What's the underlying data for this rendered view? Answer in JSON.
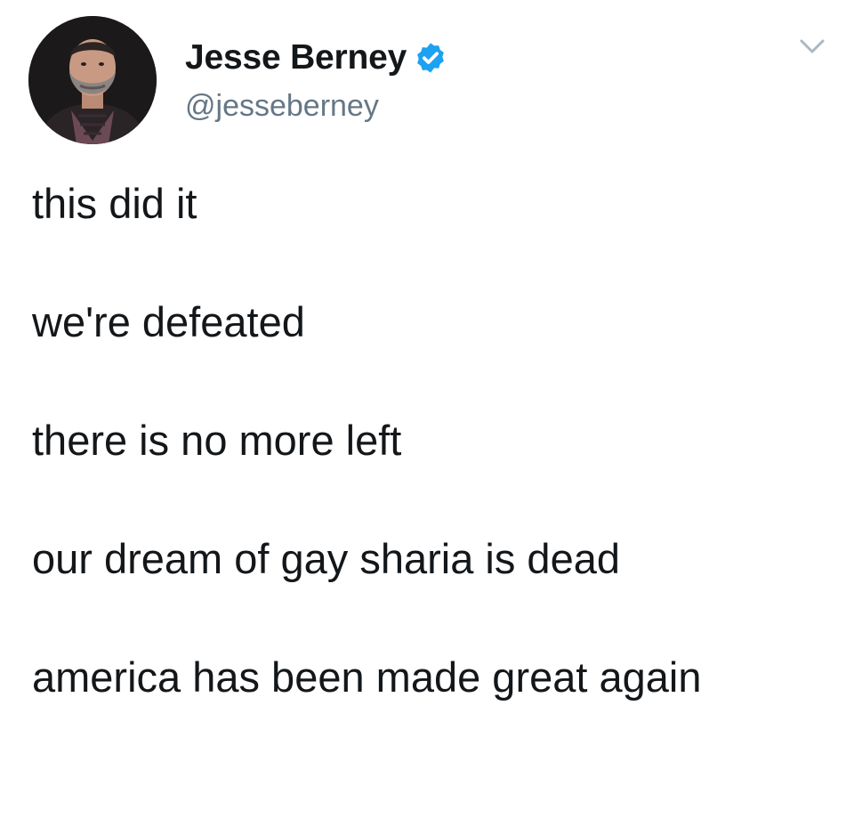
{
  "tweet": {
    "author": {
      "display_name": "Jesse Berney",
      "handle": "@jesseberney",
      "verified": true,
      "avatar_icon": "avatar-photo"
    },
    "menu_icon": "chevron-down-icon",
    "paragraphs": [
      "this did it",
      "we're defeated",
      "there is no more left",
      "our dream of gay sharia is dead",
      "america has been made great again"
    ]
  },
  "colors": {
    "text": "#14171a",
    "handle": "#657786",
    "verified_badge": "#1da1f2",
    "caret": "#aab8c2",
    "background": "#ffffff"
  }
}
